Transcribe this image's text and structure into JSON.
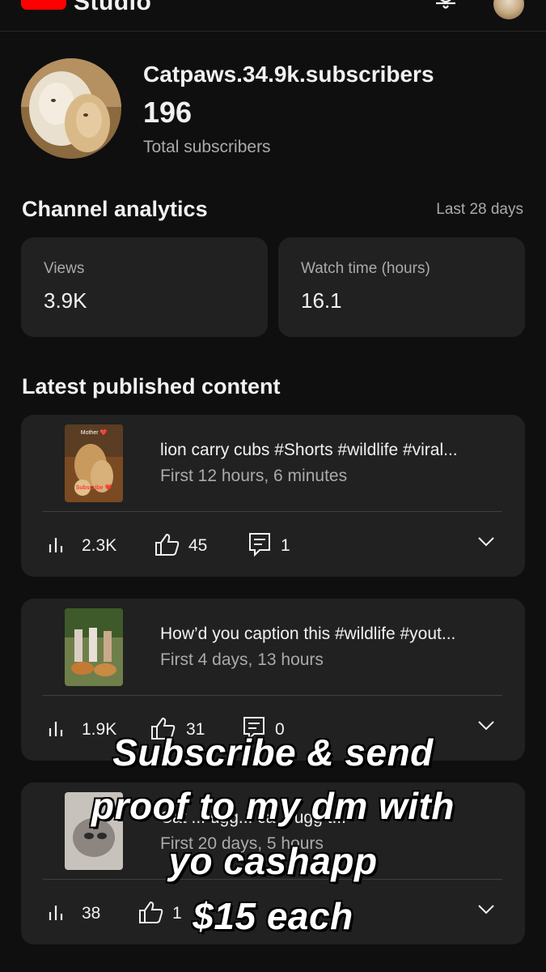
{
  "app": {
    "studio_label": "Studio"
  },
  "channel": {
    "name": "Catpaws.34.9k.subscribers",
    "subscribers": "196",
    "subscribers_label": "Total subscribers"
  },
  "analytics": {
    "title": "Channel analytics",
    "range": "Last 28 days",
    "views_label": "Views",
    "views_value": "3.9K",
    "watch_label": "Watch time (hours)",
    "watch_value": "16.1"
  },
  "latest": {
    "title": "Latest published content",
    "items": [
      {
        "title": "lion carry cubs #Shorts #wildlife #viral...",
        "period": "First 12 hours, 6 minutes",
        "views": "2.3K",
        "likes": "45",
        "comments": "1",
        "thumb_top": "Mother ❤️",
        "thumb_bottom": "Subscribe ❤️"
      },
      {
        "title": "How’d you caption this #wildlife #yout...",
        "period": "First 4 days, 13 hours",
        "views": "1.9K",
        "likes": "31",
        "comments": "0"
      },
      {
        "title": "Cat ... ugg... ca... ugg t...",
        "period": "First 20 days, 5 hours",
        "views": "38",
        "likes": "1"
      }
    ]
  },
  "overlay": {
    "lines": [
      "Subscribe & send",
      "proof to my dm with",
      "yo cashapp",
      "$15 each"
    ]
  },
  "colors": {
    "background": "#0f0f0f",
    "card": "#212121",
    "secondary_text": "#aaaaaa",
    "brand_red": "#ff0000"
  }
}
